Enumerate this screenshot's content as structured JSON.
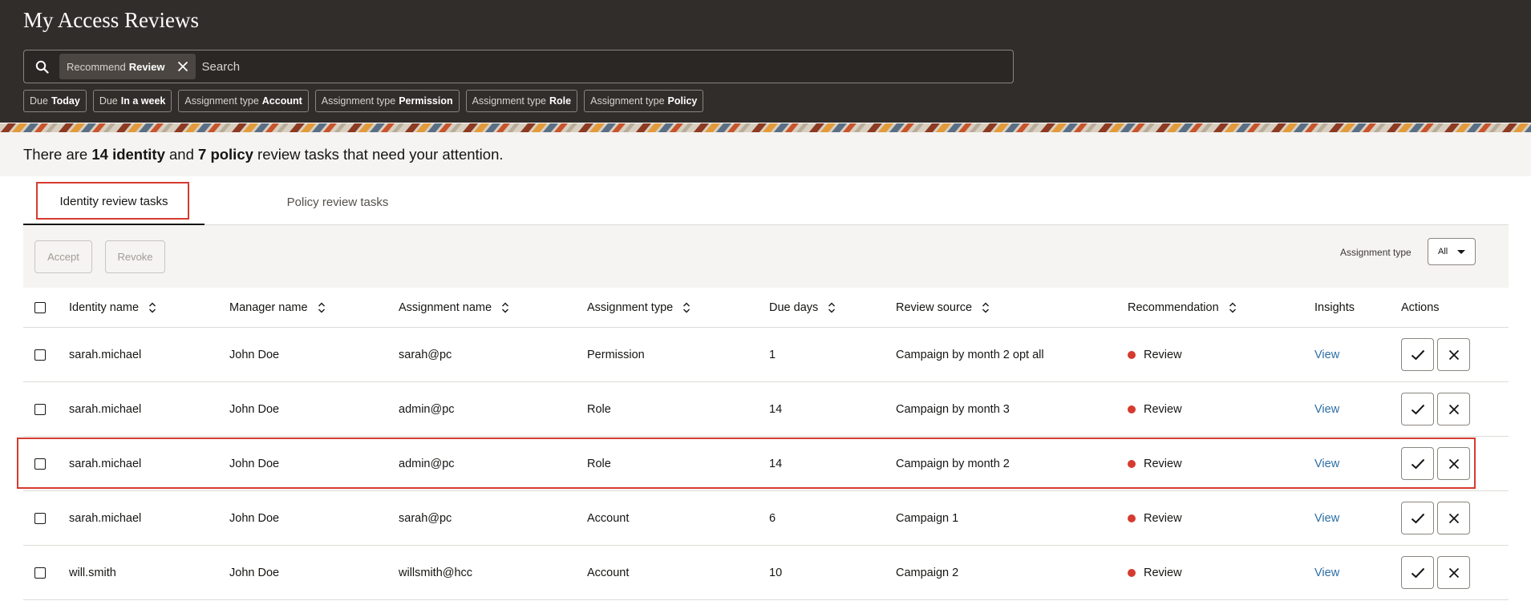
{
  "page": {
    "title": "My Access Reviews"
  },
  "search": {
    "placeholder": "Search",
    "chip": {
      "key": "Recommend",
      "value": "Review"
    }
  },
  "filters": [
    {
      "key": "Due",
      "value": "Today"
    },
    {
      "key": "Due",
      "value": "In a week"
    },
    {
      "key": "Assignment type",
      "value": "Account"
    },
    {
      "key": "Assignment type",
      "value": "Permission"
    },
    {
      "key": "Assignment type",
      "value": "Role"
    },
    {
      "key": "Assignment type",
      "value": "Policy"
    }
  ],
  "summary": {
    "prefix": "There are",
    "identity_count": "14 identity",
    "mid": "and",
    "policy_count": "7 policy",
    "suffix": "review tasks that need your attention."
  },
  "tabs": [
    {
      "label": "Identity review tasks",
      "selected": true
    },
    {
      "label": "Policy review tasks",
      "selected": false
    }
  ],
  "toolbar": {
    "accept_label": "Accept",
    "revoke_label": "Revoke",
    "assignment_type_label": "Assignment type",
    "assignment_type_value": "All"
  },
  "table": {
    "columns": [
      {
        "label": "Identity name",
        "sortable": true
      },
      {
        "label": "Manager name",
        "sortable": true
      },
      {
        "label": "Assignment name",
        "sortable": true
      },
      {
        "label": "Assignment type",
        "sortable": true
      },
      {
        "label": "Due days",
        "sortable": true
      },
      {
        "label": "Review source",
        "sortable": true
      },
      {
        "label": "Recommendation",
        "sortable": true
      },
      {
        "label": "Insights",
        "sortable": false
      },
      {
        "label": "Actions",
        "sortable": false
      }
    ],
    "rows": [
      {
        "identity": "sarah.michael",
        "manager": "John Doe",
        "assignment": "sarah@pc",
        "type": "Permission",
        "due": "1",
        "source": "Campaign by month 2 opt all",
        "recommendation": "Review",
        "insights": "View"
      },
      {
        "identity": "sarah.michael",
        "manager": "John Doe",
        "assignment": "admin@pc",
        "type": "Role",
        "due": "14",
        "source": "Campaign by month 3",
        "recommendation": "Review",
        "insights": "View"
      },
      {
        "identity": "sarah.michael",
        "manager": "John Doe",
        "assignment": "admin@pc",
        "type": "Role",
        "due": "14",
        "source": "Campaign by month 2",
        "recommendation": "Review",
        "insights": "View"
      },
      {
        "identity": "sarah.michael",
        "manager": "John Doe",
        "assignment": "sarah@pc",
        "type": "Account",
        "due": "6",
        "source": "Campaign 1",
        "recommendation": "Review",
        "insights": "View"
      },
      {
        "identity": "will.smith",
        "manager": "John Doe",
        "assignment": "willsmith@hcc",
        "type": "Account",
        "due": "10",
        "source": "Campaign 2",
        "recommendation": "Review",
        "insights": "View"
      }
    ]
  },
  "colors": {
    "header_bg": "#312d2a",
    "recommendation_dot": "#d63b30",
    "link": "#2c6ea5",
    "highlight": "#d63b30"
  },
  "icons": {
    "search": "search-icon",
    "clear": "close-icon",
    "sort": "sort-icon",
    "accept": "checkmark-icon",
    "revoke": "close-icon",
    "dropdown": "chevron-down-icon"
  }
}
